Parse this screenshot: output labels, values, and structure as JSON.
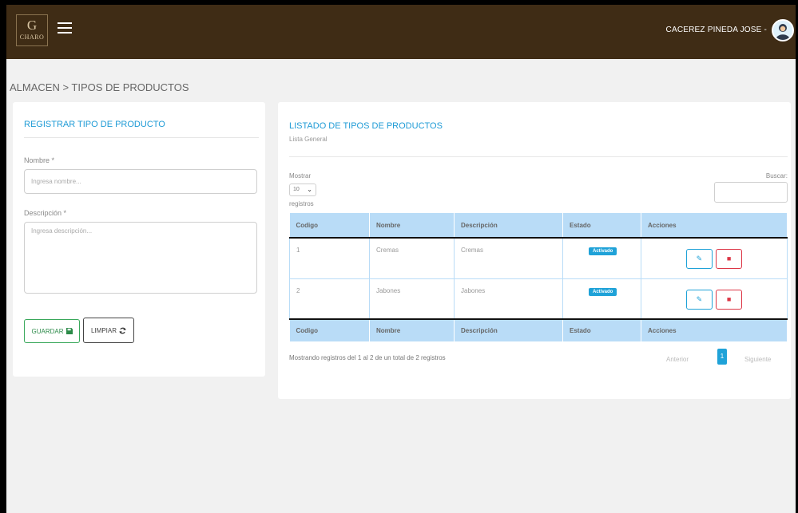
{
  "header": {
    "logo_mark": "G",
    "logo_text": "CHARO",
    "user_name": "CACEREZ PINEDA JOSE -"
  },
  "breadcrumb": "ALMACEN > TIPOS DE PRODUCTOS",
  "form": {
    "title": "REGISTRAR TIPO DE PRODUCTO",
    "name_label": "Nombre *",
    "name_placeholder": "Ingresa nombre...",
    "name_value": "",
    "desc_label": "Descripción *",
    "desc_placeholder": "Ingresa descripción...",
    "desc_value": "",
    "save_label": "GUARDAR",
    "clear_label": "LIMPIAR"
  },
  "listing": {
    "title": "LISTADO DE TIPOS DE PRODUCTOS",
    "subtitle": "Lista General",
    "show_label": "Mostrar",
    "page_size": "10",
    "records_label": "registros",
    "search_label": "Buscar:",
    "search_value": "",
    "columns": [
      "Codigo",
      "Nombre",
      "Descripción",
      "Estado",
      "Acciones"
    ],
    "rows": [
      {
        "codigo": "1",
        "nombre": "Cremas",
        "descripcion": "Cremas",
        "estado": "Activado"
      },
      {
        "codigo": "2",
        "nombre": "Jabones",
        "descripcion": "Jabones",
        "estado": "Activado"
      }
    ],
    "info": "Mostrando registros del 1 al 2 de un total de 2 registros",
    "pagination": {
      "prev": "Anterior",
      "current": "1",
      "next": "Siguiente"
    }
  },
  "colors": {
    "topbar": "#3f2c15",
    "accent": "#1fa2d8",
    "table_header": "#b9dcf7",
    "save": "#39a85b",
    "delete": "#dc3545"
  },
  "icons": [
    "menu-icon",
    "user-avatar-icon",
    "save-icon",
    "refresh-icon",
    "edit-icon",
    "delete-icon",
    "chevron-down-icon"
  ]
}
